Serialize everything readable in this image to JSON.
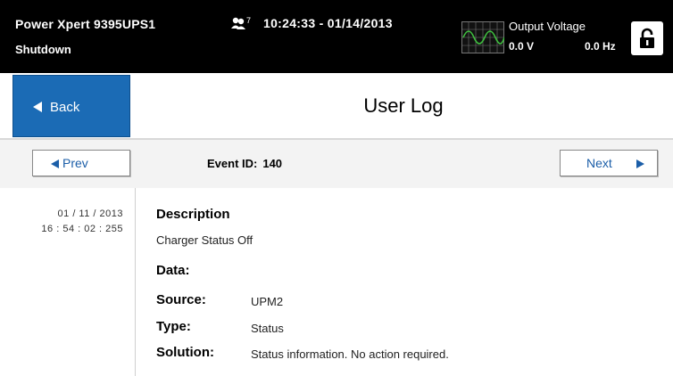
{
  "topbar": {
    "device_name": "Power Xpert 9395UPS1",
    "device_status": "Shutdown",
    "users_icon": "users-icon",
    "users_badge": "7",
    "clock": "10:24:33 - 01/14/2013",
    "output_title": "Output Voltage",
    "output_voltage": "0.0 V",
    "output_frequency": "0.0 Hz",
    "lock_icon": "unlocked-padlock-icon"
  },
  "header": {
    "back_label": "Back",
    "title": "User Log"
  },
  "nav": {
    "prev_label": "Prev",
    "next_label": "Next",
    "event_id_label": "Event ID:",
    "event_id_value": "140"
  },
  "entry": {
    "date": "01 / 11 / 2013",
    "time": "16 : 54 : 02 : 255",
    "description_label": "Description",
    "description": "Charger Status Off",
    "data_label": "Data:",
    "source_label": "Source:",
    "source": "UPM2",
    "type_label": "Type:",
    "type": "Status",
    "solution_label": "Solution:",
    "solution": "Status information. No action required."
  },
  "colors": {
    "topbar_bg": "#000000",
    "back_button": "#1b6bb5",
    "nav_accent": "#1b5ea8",
    "wave_green": "#3fbf3f"
  }
}
